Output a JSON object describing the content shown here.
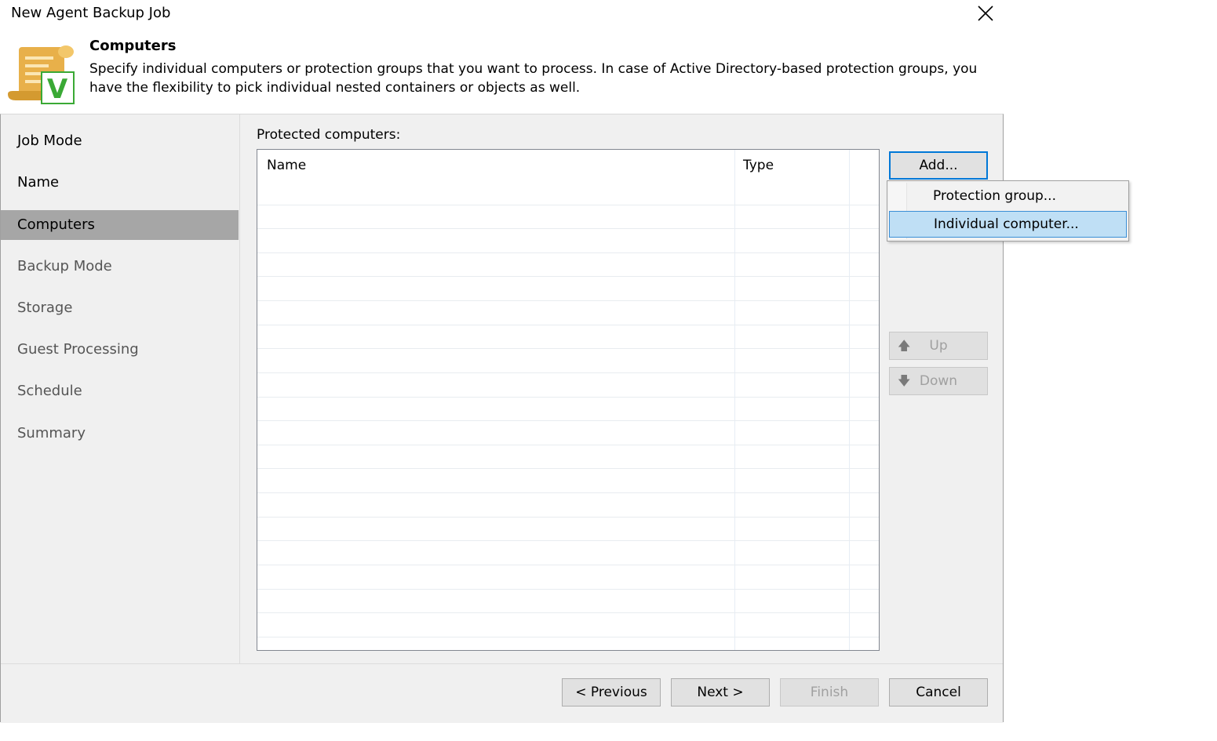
{
  "window": {
    "title": "New Agent Backup Job"
  },
  "header": {
    "title": "Computers",
    "description": "Specify individual computers or protection groups that you want to process. In case of Active Directory-based protection groups, you have the flexibility to pick individual nested containers or objects as well."
  },
  "nav": {
    "items": [
      {
        "label": "Job Mode",
        "state": "done"
      },
      {
        "label": "Name",
        "state": "done"
      },
      {
        "label": "Computers",
        "state": "active"
      },
      {
        "label": "Backup Mode",
        "state": "pending"
      },
      {
        "label": "Storage",
        "state": "pending"
      },
      {
        "label": "Guest Processing",
        "state": "pending"
      },
      {
        "label": "Schedule",
        "state": "pending"
      },
      {
        "label": "Summary",
        "state": "pending"
      }
    ]
  },
  "content": {
    "list_label": "Protected computers:",
    "columns": [
      "Name",
      "Type"
    ],
    "rows": []
  },
  "side_buttons": {
    "add": "Add...",
    "up": "Up",
    "down": "Down"
  },
  "add_menu": {
    "items": [
      "Protection group...",
      "Individual computer..."
    ],
    "highlighted": "Individual computer..."
  },
  "footer": {
    "previous": "< Previous",
    "next": "Next >",
    "finish": "Finish",
    "cancel": "Cancel"
  },
  "colors": {
    "active_nav": "#a6a6a6",
    "menu_highlight": "#bfdff5",
    "focus_border": "#0078d7",
    "icon_gold": "#e8b04a",
    "icon_green": "#3aa935"
  }
}
